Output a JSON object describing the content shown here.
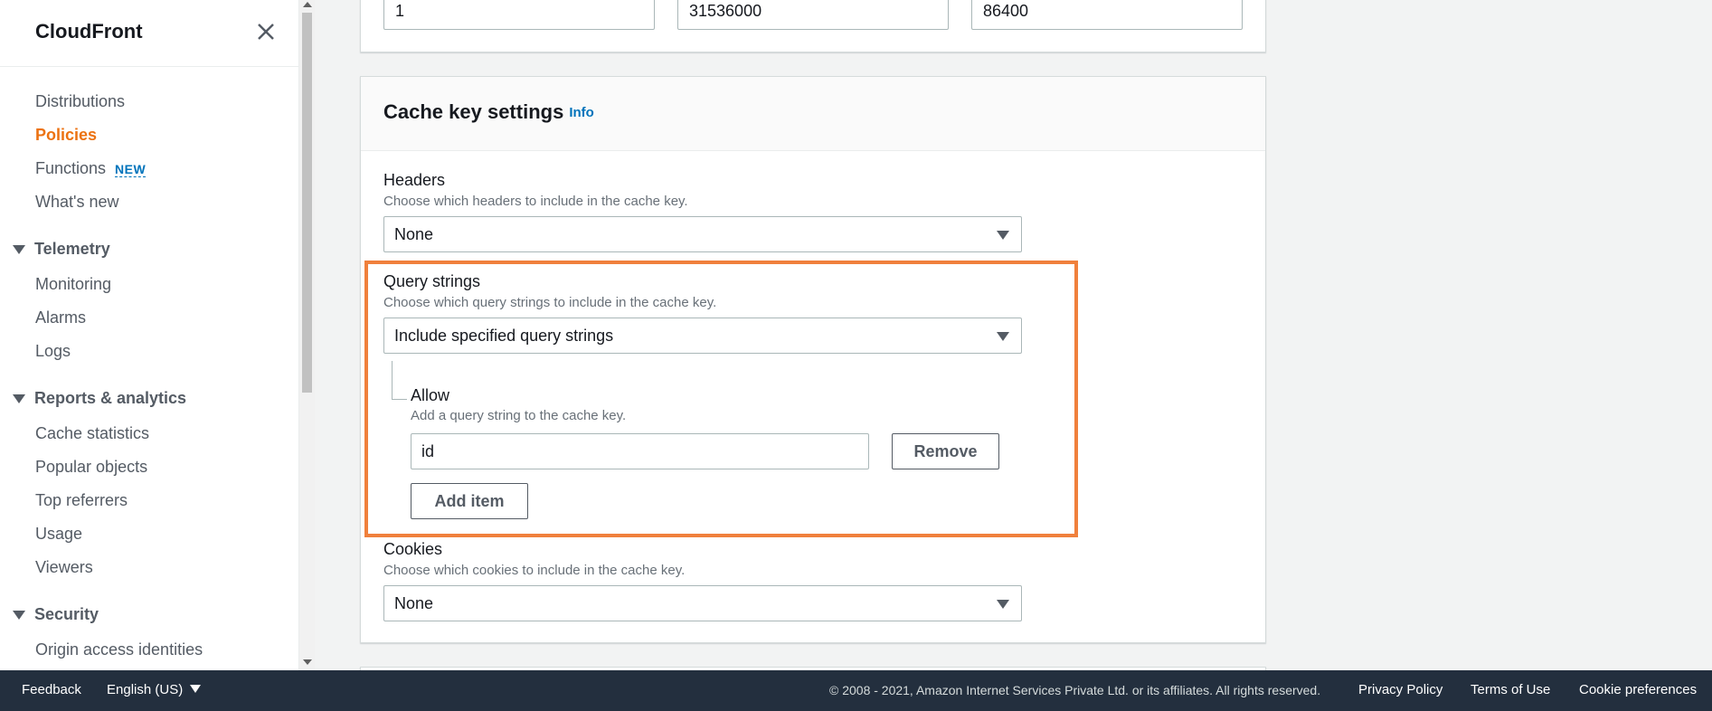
{
  "sidebar": {
    "title": "CloudFront",
    "nav": [
      {
        "label": "Distributions",
        "active": false
      },
      {
        "label": "Policies",
        "active": true
      },
      {
        "label": "Functions",
        "badge": "NEW",
        "active": false
      },
      {
        "label": "What's new",
        "active": false
      }
    ],
    "telemetry": {
      "heading": "Telemetry",
      "items": [
        "Monitoring",
        "Alarms",
        "Logs"
      ]
    },
    "reports": {
      "heading": "Reports & analytics",
      "items": [
        "Cache statistics",
        "Popular objects",
        "Top referrers",
        "Usage",
        "Viewers"
      ]
    },
    "security": {
      "heading": "Security",
      "items": [
        "Origin access identities"
      ]
    }
  },
  "ttl": {
    "min_value": "1",
    "max_value": "31536000",
    "default_value": "86400"
  },
  "cache_key": {
    "title": "Cache key settings",
    "info_label": "Info",
    "headers": {
      "label": "Headers",
      "description": "Choose which headers to include in the cache key.",
      "value": "None"
    },
    "query_strings": {
      "label": "Query strings",
      "description": "Choose which query strings to include in the cache key.",
      "value": "Include specified query strings",
      "allow": {
        "label": "Allow",
        "description": "Add a query string to the cache key.",
        "item_value": "id",
        "remove_label": "Remove",
        "add_label": "Add item"
      }
    },
    "cookies": {
      "label": "Cookies",
      "description": "Choose which cookies to include in the cache key.",
      "value": "None"
    }
  },
  "footer": {
    "feedback": "Feedback",
    "language": "English (US)",
    "copyright": "© 2008 - 2021, Amazon Internet Services Private Ltd. or its affiliates. All rights reserved.",
    "privacy": "Privacy Policy",
    "terms": "Terms of Use",
    "cookies": "Cookie preferences"
  },
  "colors": {
    "accent": "#ec7211",
    "link": "#0073bb",
    "highlight": "#f0803c",
    "footer_bg": "#232f3e"
  }
}
